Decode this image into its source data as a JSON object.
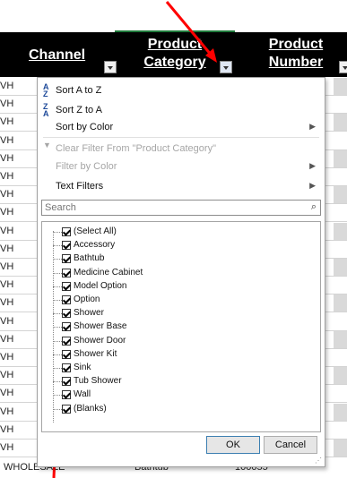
{
  "header": {
    "channel": "Channel",
    "category": "Product Category",
    "number": "Product Number"
  },
  "sheet": {
    "row_prefix": "VH",
    "bottom_row": {
      "channel": "WHOLESALE",
      "category": "Bathtub",
      "number": "100055"
    }
  },
  "menu": {
    "sort_az": "Sort A to Z",
    "sort_za": "Sort Z to A",
    "sort_color": "Sort by Color",
    "clear_filter": "Clear Filter From \"Product Category\"",
    "filter_color": "Filter by Color",
    "text_filters": "Text Filters",
    "search_placeholder": "Search",
    "items": [
      "(Select All)",
      "Accessory",
      "Bathtub",
      "Medicine Cabinet",
      "Model Option",
      "Option",
      "Shower",
      "Shower Base",
      "Shower Door",
      "Shower Kit",
      "Sink",
      "Tub Shower",
      "Wall",
      "(Blanks)"
    ],
    "ok": "OK",
    "cancel": "Cancel"
  },
  "colors": {
    "annotation": "#ff0000",
    "header_bg": "#000000"
  }
}
